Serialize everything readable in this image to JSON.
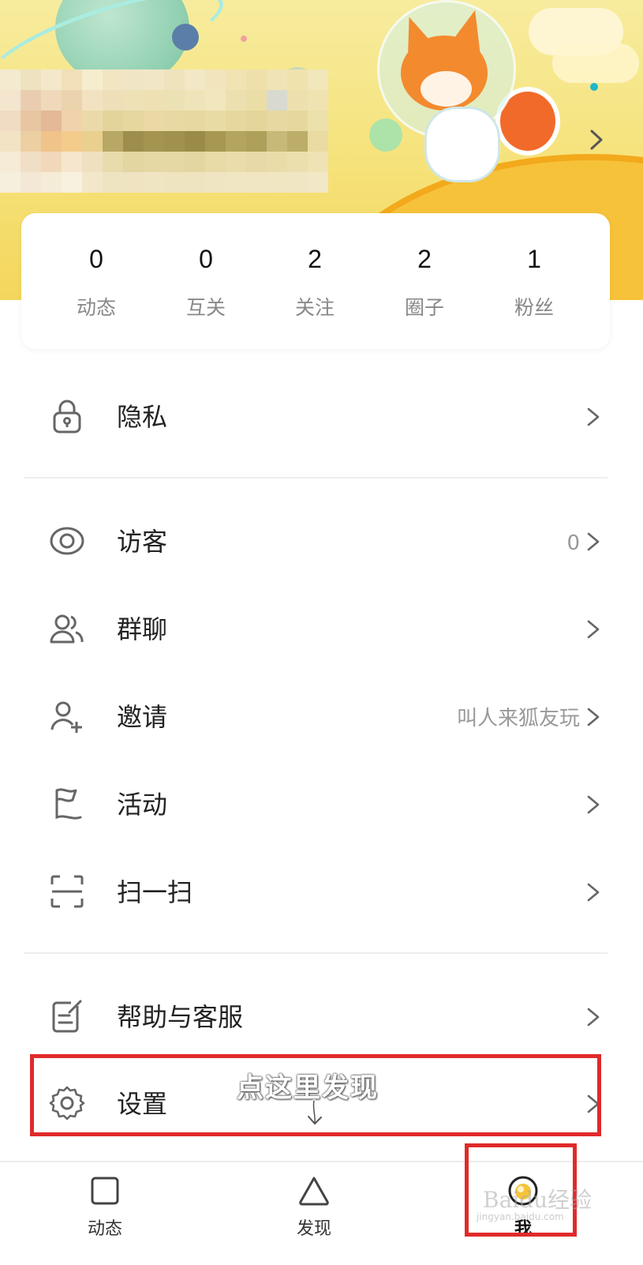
{
  "stats": [
    {
      "value": "0",
      "label": "动态"
    },
    {
      "value": "0",
      "label": "互关"
    },
    {
      "value": "2",
      "label": "关注"
    },
    {
      "value": "2",
      "label": "圈子"
    },
    {
      "value": "1",
      "label": "粉丝"
    }
  ],
  "menu": {
    "privacy": {
      "label": "隐私",
      "icon": "lock-icon"
    },
    "visitors": {
      "label": "访客",
      "extra": "0",
      "icon": "eye-icon"
    },
    "group_chat": {
      "label": "群聊",
      "icon": "group-icon"
    },
    "invite": {
      "label": "邀请",
      "extra": "叫人来狐友玩",
      "icon": "add-user-icon"
    },
    "activity": {
      "label": "活动",
      "icon": "flag-icon"
    },
    "scan": {
      "label": "扫一扫",
      "icon": "scan-icon"
    },
    "help": {
      "label": "帮助与客服",
      "icon": "feedback-icon"
    },
    "settings": {
      "label": "设置",
      "icon": "gear-icon"
    }
  },
  "annotation": {
    "text": "点这里发现",
    "color": "#e02a2a"
  },
  "tabs": [
    {
      "label": "动态",
      "icon": "square-icon"
    },
    {
      "label": "发现",
      "icon": "triangle-icon"
    },
    {
      "label": "我",
      "icon": "avatar-icon"
    }
  ],
  "watermark": {
    "text": "Baidu经验",
    "subtext": "jingyan.baidu.com"
  },
  "colors": {
    "accent": "#f6c23a",
    "text": "#222222",
    "muted": "#888888",
    "annotation": "#e02a2a"
  }
}
